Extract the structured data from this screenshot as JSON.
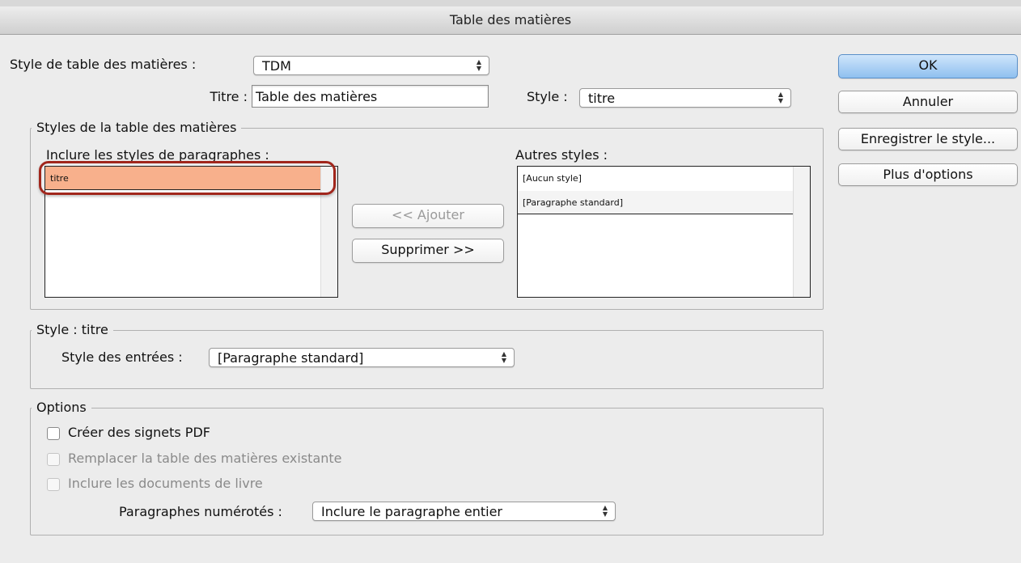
{
  "window": {
    "title": "Table des matières"
  },
  "toc_style": {
    "label": "Style de table des matières :",
    "value": "TDM"
  },
  "title": {
    "label": "Titre :",
    "value": "Table des matières"
  },
  "title_style": {
    "label": "Style :",
    "value": "titre"
  },
  "buttons": {
    "ok": "OK",
    "cancel": "Annuler",
    "save_style": "Enregistrer le style...",
    "more_options": "Plus d'options",
    "add": "<< Ajouter",
    "remove": "Supprimer >>"
  },
  "styles_group": {
    "title": "Styles de la table des matières",
    "include_label": "Inclure les styles de paragraphes :",
    "include_items": [
      "titre"
    ],
    "other_label": "Autres styles :",
    "other_items": [
      "[Aucun style]",
      "[Paragraphe standard]"
    ]
  },
  "style_group": {
    "title": "Style : titre",
    "entry_style_label": "Style des entrées :",
    "entry_style_value": "[Paragraphe standard]"
  },
  "options_group": {
    "title": "Options",
    "create_pdf_bookmarks": {
      "label": "Créer des signets PDF",
      "checked": false,
      "enabled": true
    },
    "replace_existing": {
      "label": "Remplacer la table des matières existante",
      "checked": false,
      "enabled": false
    },
    "include_book_docs": {
      "label": "Inclure les documents de livre",
      "checked": false,
      "enabled": false
    },
    "numbered_paragraphs_label": "Paragraphes numérotés :",
    "numbered_paragraphs_value": "Inclure le paragraphe entier"
  },
  "colors": {
    "selected_row": "#f8b08c",
    "highlight_ring": "#a1261c",
    "default_button": "#8fc0ef"
  }
}
